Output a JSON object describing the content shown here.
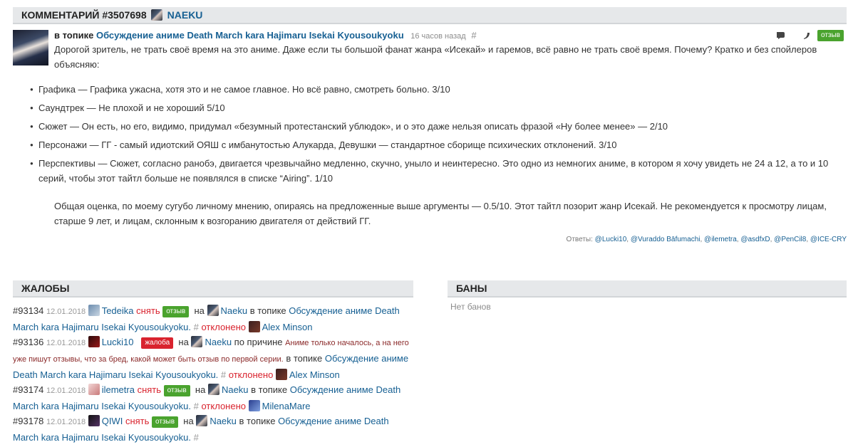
{
  "header": {
    "title": "КОММЕНТАРИЙ #3507698",
    "user": "NAEKU"
  },
  "comment": {
    "prefix": "в топике",
    "topic": "Обсуждение аниме Death March kara Hajimaru Isekai Kyousoukyoku",
    "time": "16 часов назад",
    "hash": "#",
    "badge": "отзыв",
    "intro": "Дорогой зритель, не трать своё время на это аниме. Даже если ты большой фанат жанра «Исекай» и гаремов, всё равно не трать своё время. Почему? Кратко и без спойлеров объясняю:",
    "points": [
      "Графика — Графика ужасна, хотя это и не самое главное. Но всё равно, смотреть больно. 3/10",
      "Саундтрек — Не плохой и не хороший 5/10",
      "Сюжет — Он есть, но его, видимо, придумал «безумный протестанский ублюдок», и о это даже нельзя описать фразой «Ну более менее» — 2/10",
      "Персонажи — ГГ - самый идиотский ОЯШ с имбанутостью Алукарда, Девушки — стандартное сборище психических отклонений. 3/10",
      "Перспективы — Сюжет, согласно ранобэ, двигается чрезвычайно медленно, скучно, уныло и неинтересно. Это одно из немногих аниме, в котором я хочу увидеть не 24 а 12, а то и 10 серий, чтобы этот тайтл больше не появлялся в списке “Airing”. 1/10"
    ],
    "summary": "Общая оценка, по моему сугубо личному мнению, опираясь на предложенные выше аргументы — 0.5/10. Этот тайтл позорит жанр Исекай. Не рекомендуется к просмотру лицам, старше 9 лет, и лицам, склонным к возгоранию двигателя от действий ГГ.",
    "answers_label": "Ответы:",
    "answers": [
      "@Lucki10",
      "@Vuraddo Bāfumachi",
      "@ilemetra",
      "@asdfxD",
      "@PenCil8",
      "@ICE-CRY"
    ]
  },
  "complaints": {
    "title": "ЖАЛОБЫ",
    "items": [
      {
        "num": "#93134",
        "date": "12.01.2018",
        "user": "Tedeika",
        "remove": "снять",
        "badge": "отзыв",
        "on": "на",
        "target": "Naeku",
        "in_topic": "в топике",
        "topic": "Обсуждение аниме Death March kara Hajimaru Isekai Kyousoukyoku.",
        "hash": "#",
        "status": "отклонено",
        "moderator": "Alex Minson"
      },
      {
        "num": "#93136",
        "date": "12.01.2018",
        "user": "Lucki10",
        "badge": "жалоба",
        "on": "на",
        "target": "Naeku",
        "because": "по причине",
        "reason": "Аниме только началось, а на него уже пишут отзывы, что за бред, какой может быть отзыв по первой серии.",
        "in_topic": "в топике",
        "topic": "Обсуждение аниме Death March kara Hajimaru Isekai Kyousoukyoku.",
        "hash": "#",
        "status": "отклонено",
        "moderator": "Alex Minson"
      },
      {
        "num": "#93174",
        "date": "12.01.2018",
        "user": "ilemetra",
        "remove": "снять",
        "badge": "отзыв",
        "on": "на",
        "target": "Naeku",
        "in_topic": "в топике",
        "topic": "Обсуждение аниме Death March kara Hajimaru Isekai Kyousoukyoku.",
        "hash": "#",
        "status": "отклонено",
        "moderator": "MilenaMare"
      },
      {
        "num": "#93178",
        "date": "12.01.2018",
        "user": "QIWI",
        "remove": "снять",
        "badge": "отзыв",
        "on": "на",
        "target": "Naeku",
        "in_topic": "в топике",
        "topic": "Обсуждение аниме Death March kara Hajimaru Isekai Kyousoukyoku.",
        "hash": "#"
      }
    ]
  },
  "bans": {
    "title": "БАНЫ",
    "empty": "Нет банов"
  },
  "colors": {
    "link": "#176093",
    "green_badge": "#4aa32e",
    "red_badge": "#d9232e",
    "header_bg": "#e6e8ea"
  }
}
